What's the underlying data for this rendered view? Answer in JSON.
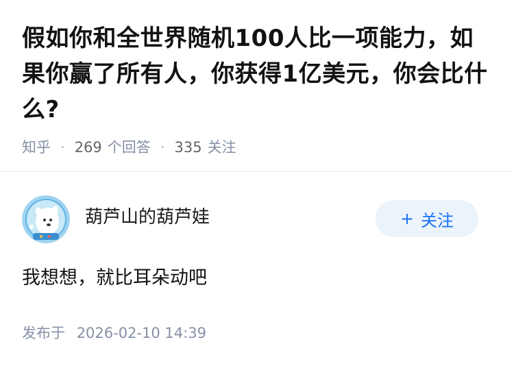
{
  "question": {
    "title": "假如你和全世界随机100人比一项能力，如果你赢了所有人，你获得1亿美元，你会比什么?",
    "source": "知乎",
    "separator": "·",
    "answer_count": "269",
    "answer_label": "个回答",
    "follow_count": "335",
    "follow_label": "关注"
  },
  "answer": {
    "author_name": "葫芦山的葫芦娃",
    "avatar_icon": "astronaut-dog-avatar",
    "follow_button": {
      "plus": "+",
      "label": "关注"
    },
    "content": "我想想，就比耳朵动吧",
    "published_label": "发布于",
    "published_time": "2026-02-10 14:39"
  },
  "colors": {
    "title": "#121212",
    "meta": "#8590a6",
    "follow_bg": "#ebf3fb",
    "follow_text": "#1772f6",
    "divider": "#ebebeb"
  }
}
